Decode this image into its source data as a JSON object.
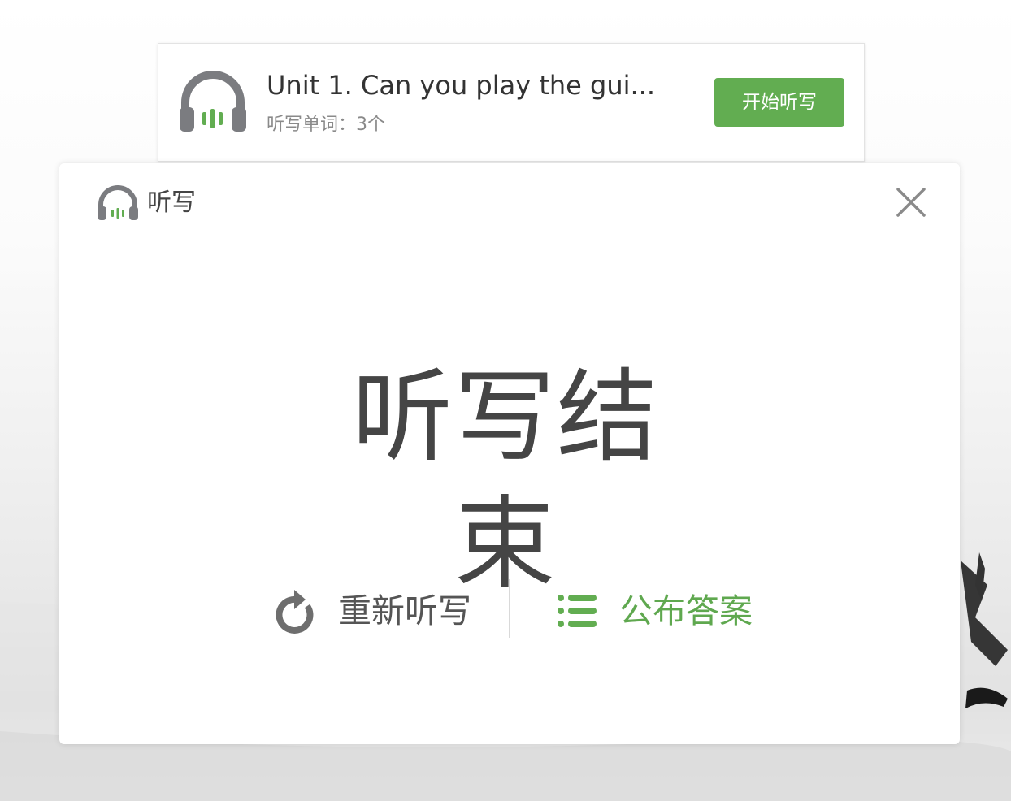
{
  "task_card": {
    "title": "Unit 1. Can you play the gui...",
    "subtitle": "听写单词：3个",
    "start_button": "开始听写",
    "icon": "headphones-icon"
  },
  "modal": {
    "title": "听写",
    "title_icon": "headphones-icon",
    "close_icon": "close-icon",
    "status_text": "听写结束",
    "actions": {
      "redo_label": "重新听写",
      "redo_icon": "refresh-icon",
      "publish_label": "公布答案",
      "publish_icon": "list-icon"
    }
  },
  "colors": {
    "accent_green": "#62ad51",
    "icon_gray": "#7b7c80",
    "text_dark": "#454545"
  }
}
